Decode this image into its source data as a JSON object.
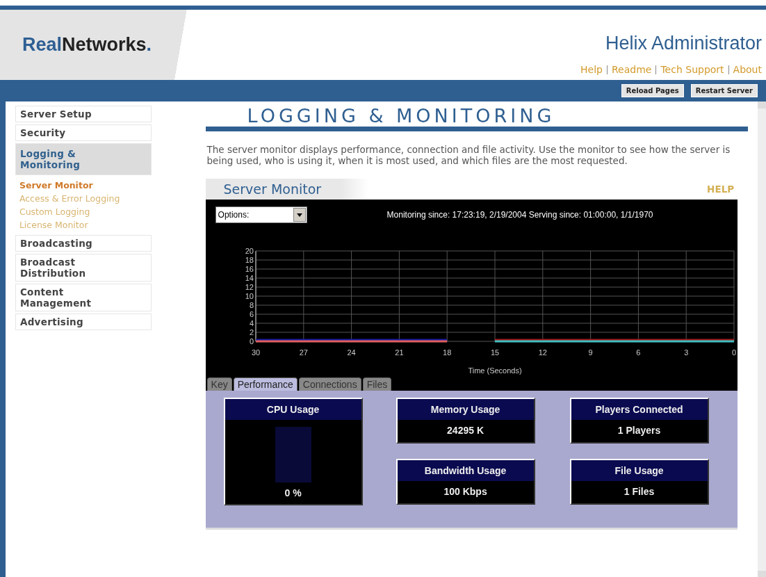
{
  "header": {
    "logo": [
      {
        "text": "Real",
        "kind": "accent"
      },
      {
        "text": "Networks",
        "kind": "plain"
      },
      {
        "text": ".",
        "kind": "accent"
      }
    ],
    "title": "Helix Administrator",
    "links": [
      "Help",
      "Readme",
      "Tech Support",
      "About"
    ],
    "buttons": [
      "Reload Pages",
      "Restart Server"
    ]
  },
  "sidebar": {
    "items": [
      {
        "label": "Server Setup",
        "selected": false
      },
      {
        "label": "Security",
        "selected": false
      },
      {
        "label": "Logging & Monitoring",
        "selected": true,
        "children": [
          {
            "label": "Server Monitor",
            "selected": true
          },
          {
            "label": "Access & Error Logging",
            "selected": false
          },
          {
            "label": "Custom Logging",
            "selected": false
          },
          {
            "label": "License Monitor",
            "selected": false
          }
        ]
      },
      {
        "label": "Broadcasting",
        "selected": false
      },
      {
        "label": "Broadcast Distribution",
        "selected": false
      },
      {
        "label": "Content Management",
        "selected": false
      },
      {
        "label": "Advertising",
        "selected": false
      }
    ]
  },
  "page": {
    "heading": "LOGGING & MONITORING",
    "description": "The server monitor displays performance, connection and file activity. Use the monitor to see how the server is being used, who is using it, when it is most used, and which files are the most requested."
  },
  "monitor": {
    "title": "Server Monitor",
    "help": "HELP",
    "options": {
      "value": "Options:"
    },
    "status": "Monitoring since: 17:23:19, 2/19/2004 Serving since: 01:00:00, 1/1/1970",
    "chart_data": {
      "type": "line",
      "xlabel": "Time (Seconds)",
      "grid": true,
      "x": [
        30,
        27,
        24,
        21,
        18,
        15,
        12,
        9,
        6,
        3,
        0
      ],
      "xlim": [
        30,
        0
      ],
      "ylim": [
        0,
        20
      ],
      "xticks": [
        30,
        27,
        24,
        21,
        18,
        15,
        12,
        9,
        6,
        3,
        0
      ],
      "yticks": [
        0,
        2,
        4,
        6,
        8,
        10,
        12,
        14,
        16,
        18,
        20
      ],
      "series": [
        {
          "color": "#1a1aa0",
          "values": [
            0.3,
            0.3,
            0.3,
            0.3,
            0.3,
            null,
            null,
            null,
            null,
            null,
            null
          ]
        },
        {
          "color": "#a01818",
          "values": [
            null,
            null,
            null,
            null,
            null,
            0.3,
            0.3,
            0.3,
            0.3,
            0.3,
            0.3
          ]
        },
        {
          "color": "#e06060",
          "values": [
            0,
            0,
            0,
            0,
            0,
            null,
            null,
            null,
            null,
            null,
            null
          ]
        },
        {
          "color": "#40c0c0",
          "values": [
            null,
            null,
            null,
            null,
            null,
            0,
            0,
            0,
            0,
            0,
            0
          ]
        }
      ]
    },
    "tabs": [
      {
        "label": "Key",
        "selected": false
      },
      {
        "label": "Performance",
        "selected": true
      },
      {
        "label": "Connections",
        "selected": false
      },
      {
        "label": "Files",
        "selected": false
      }
    ],
    "cards": [
      {
        "kind": "meter",
        "title": "CPU Usage",
        "value": "0 %",
        "level": 0
      },
      {
        "kind": "value",
        "title": "Memory Usage",
        "value": "24295 K"
      },
      {
        "kind": "value",
        "title": "Players Connected",
        "value": "1 Players"
      },
      {
        "kind": "value",
        "title": "Bandwidth Usage",
        "value": "100 Kbps"
      },
      {
        "kind": "value",
        "title": "File Usage",
        "value": "1 Files"
      }
    ]
  }
}
